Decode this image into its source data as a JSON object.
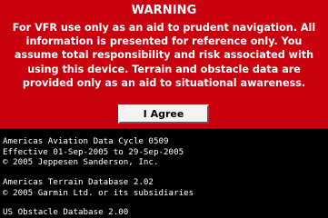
{
  "warning": {
    "title": "WARNING",
    "lines": [
      "For VFR use only as an aid to prudent navigation.  All",
      "information is presented for reference only.  You",
      "assume total responsibility and risk associated with",
      "using this device.  Terrain and obstacle data are",
      "provided only as an aid to situational awareness."
    ]
  },
  "button": {
    "label": "I Agree"
  },
  "databases": {
    "aviation": [
      "Americas Aviation Data Cycle 0509",
      "Effective 01-Sep-2005 to 29-Sep-2005",
      "© 2005 Jeppesen Sanderson, Inc."
    ],
    "terrain": [
      "Americas Terrain Database 2.02",
      "© 2005 Garmin Ltd. or its subsidiaries"
    ],
    "obstacle": [
      "US Obstacle Database 2.00"
    ]
  },
  "colors": {
    "warning_background": "#c9000d",
    "button_background": "#f3f3f3",
    "screen_background": "#000000",
    "text": "#ffffff"
  }
}
